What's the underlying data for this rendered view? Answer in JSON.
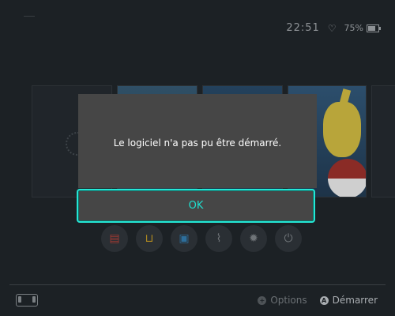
{
  "status_bar": {
    "time": "22:51",
    "battery_percent": "75%",
    "battery_level": 0.75,
    "wifi_icon": "heart-outline-icon"
  },
  "home_icons": [
    {
      "name": "news-icon",
      "color": "#a03a32"
    },
    {
      "name": "shop-icon",
      "color": "#b08a20"
    },
    {
      "name": "album-icon",
      "color": "#2d6e9b"
    },
    {
      "name": "controllers-icon",
      "color": "#6f7478"
    },
    {
      "name": "settings-icon",
      "color": "#6f7478"
    },
    {
      "name": "power-icon",
      "color": "#6f7478"
    }
  ],
  "footer": {
    "options_label": "Options",
    "start_label": "Démarrer",
    "options_button": "+",
    "start_button": "A"
  },
  "dialog": {
    "message": "Le logiciel n'a pas pu être démarré.",
    "ok_label": "OK",
    "accent_color": "#24e7d5"
  }
}
